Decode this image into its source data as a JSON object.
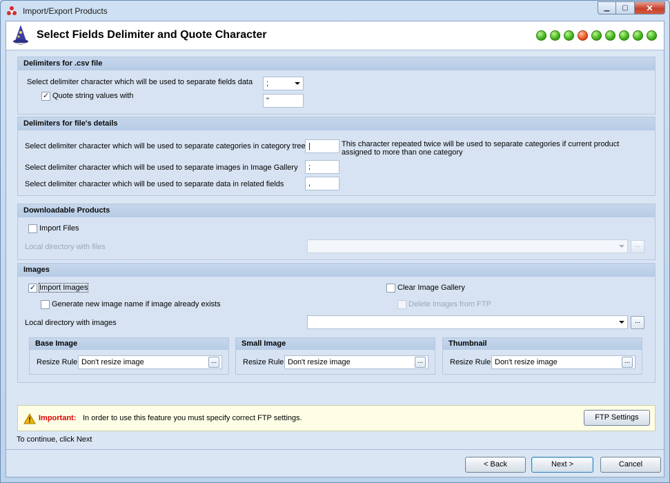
{
  "window": {
    "title": "Import/Export Products"
  },
  "header": {
    "title": "Select Fields Delimiter and Quote Character",
    "steps": [
      "done",
      "done",
      "done",
      "current",
      "done",
      "done",
      "done",
      "done",
      "done"
    ]
  },
  "csv": {
    "heading": "Delimiters for .csv file",
    "delimiter_label": "Select delimiter character which will be used to separate fields data",
    "delimiter_value": ";",
    "quote_checkbox_label": "Quote string values with",
    "quote_checked": true,
    "quote_value": "\""
  },
  "details": {
    "heading": "Delimiters for file's details",
    "category_label": "Select delimiter character which will be used to separate categories in category tree",
    "category_value": "|",
    "category_note": "This character repeated twice will be used to separate categories if current product assigned to more than one category",
    "images_label": "Select delimiter character which will be used to separate images in Image Gallery",
    "images_value": ";",
    "related_label": "Select delimiter character which will be used to separate data in related fields",
    "related_value": ","
  },
  "downloadable": {
    "heading": "Downloadable Products",
    "import_files_label": "Import Files",
    "import_files_checked": false,
    "local_dir_label": "Local directory with files",
    "local_dir_value": "",
    "browse_label": "..."
  },
  "images": {
    "heading": "Images",
    "import_images_label": "Import Images",
    "import_images_checked": true,
    "generate_name_label": "Generate new image name if image already exists",
    "generate_name_checked": false,
    "clear_gallery_label": "Clear Image Gallery",
    "clear_gallery_checked": false,
    "delete_ftp_label": "Delete Images from FTP",
    "delete_ftp_checked": false,
    "local_dir_label": "Local directory with images",
    "local_dir_value": "",
    "browse_label": "...",
    "base": {
      "heading": "Base Image",
      "rule_label": "Resize Rule",
      "rule_value": "Don't resize image",
      "btn": "..."
    },
    "small": {
      "heading": "Small Image",
      "rule_label": "Resize Rule",
      "rule_value": "Don't resize image",
      "btn": "..."
    },
    "thumb": {
      "heading": "Thumbnail",
      "rule_label": "Resize Rule",
      "rule_value": "Don't resize image",
      "btn": "..."
    }
  },
  "notice": {
    "important_label": "Important:",
    "message": "In order to use this feature you must specify correct FTP settings.",
    "ftp_button": "FTP Settings"
  },
  "status": {
    "hint": "To continue, click Next"
  },
  "nav": {
    "back": "< Back",
    "next": "Next >",
    "cancel": "Cancel"
  },
  "colors": {
    "accent_step_done": "#3fb11a",
    "accent_step_current": "#e8541f",
    "important": "#e00000"
  }
}
